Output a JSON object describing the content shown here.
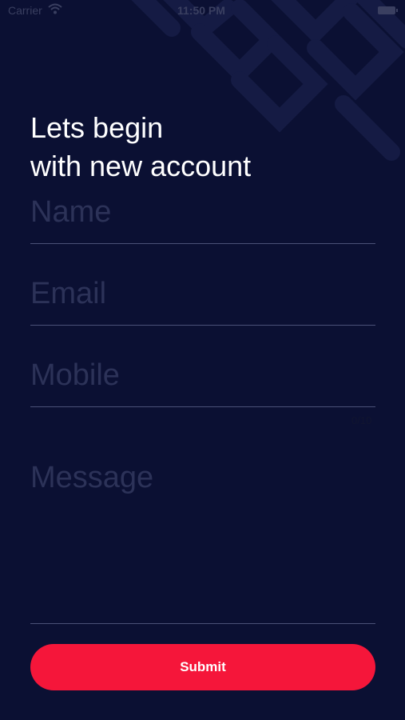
{
  "status_bar": {
    "carrier": "Carrier",
    "time": "11:50 PM",
    "icons": [
      "wifi-icon",
      "battery-icon"
    ]
  },
  "heading": {
    "line1": "Lets begin",
    "line2": "with new account"
  },
  "form": {
    "name_placeholder": "Name",
    "email_placeholder": "Email",
    "mobile_placeholder": "Mobile",
    "mobile_counter": "0/10",
    "message_placeholder": "Message",
    "submit_label": "Submit"
  },
  "colors": {
    "background": "#0b1033",
    "accent": "#f5163a",
    "placeholder": "#2c3258",
    "divider": "#4b5177"
  }
}
